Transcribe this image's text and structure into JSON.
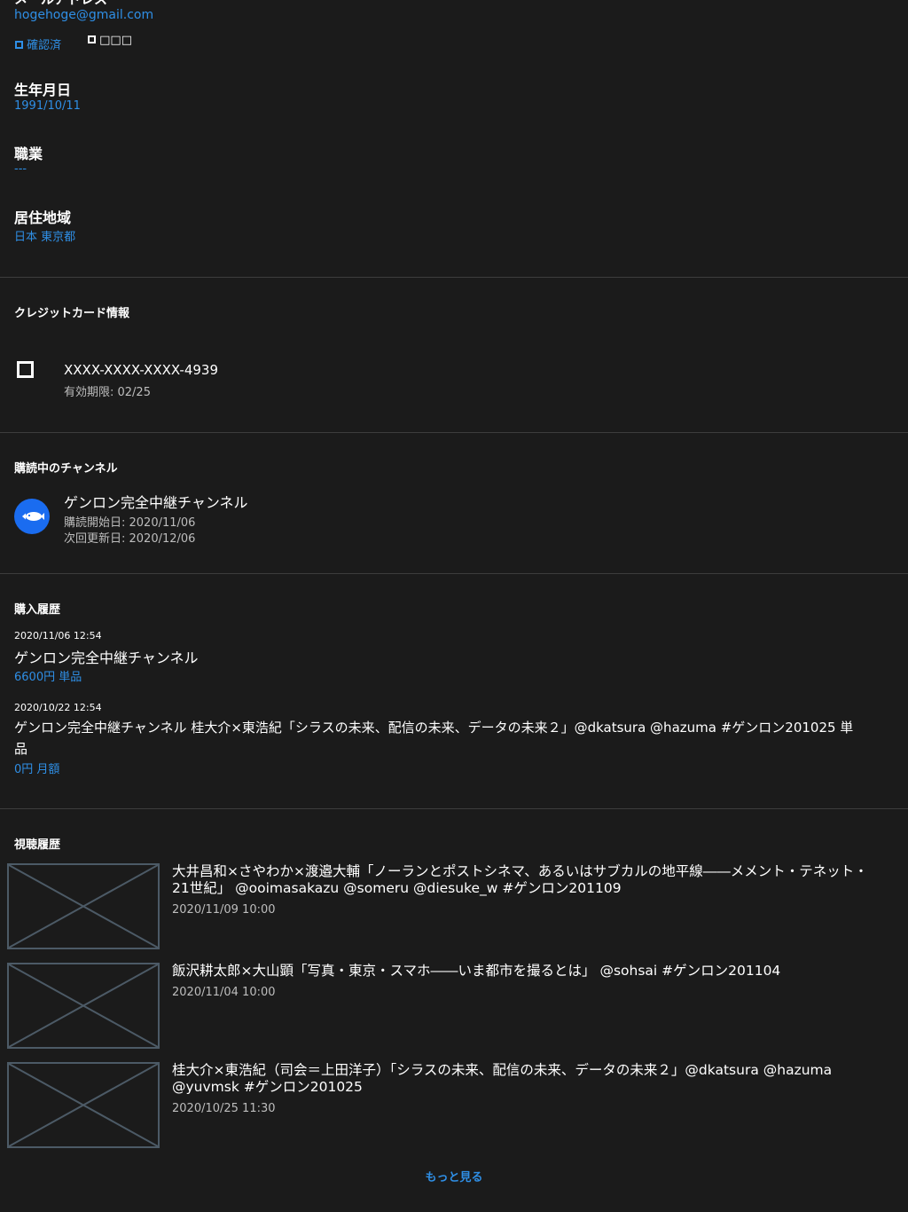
{
  "account": {
    "email_label_partial": "メールアドレス",
    "email": "hogehoge@gmail.com",
    "verified_label": "確認済",
    "unverified_marks": "□□□",
    "birthday_label": "生年月日",
    "birthday": "1991/10/11",
    "occupation_label": "職業",
    "occupation": "---",
    "region_label": "居住地域",
    "region": "日本 東京都"
  },
  "credit_card": {
    "section_title": "クレジットカード情報",
    "number": "XXXX-XXXX-XXXX-4939",
    "expiry": "有効期限: 02/25"
  },
  "subscriptions": {
    "section_title": "購読中のチャンネル",
    "items": [
      {
        "name": "ゲンロン完全中継チャンネル",
        "start": "購読開始日: 2020/11/06",
        "renew": "次回更新日: 2020/12/06",
        "icon": "fish-icon",
        "icon_color": "#1a6cf0"
      }
    ]
  },
  "purchases": {
    "section_title": "購入履歴",
    "items": [
      {
        "datetime": "2020/11/06 12:54",
        "title": "ゲンロン完全中継チャンネル",
        "price": "6600円 単品"
      },
      {
        "datetime": "2020/10/22 12:54",
        "title_line1": "ゲンロン完全中継チャンネル 桂大介×東浩紀「シラスの未来、配信の未来、データの未来２」@dkatsura @hazuma #ゲンロン201025 単",
        "title_line2": "品",
        "price": "0円 月額"
      }
    ]
  },
  "history": {
    "section_title": "視聴履歴",
    "items": [
      {
        "title_line1": "大井昌和×さやわか×渡邉大輔「ノーランとポストシネマ、あるいはサブカルの地平線――メメント・テネット・",
        "title_line2": "21世紀」 @ooimasakazu @someru @diesuke_w #ゲンロン201109",
        "date": "2020/11/09 10:00"
      },
      {
        "title_line1": "飯沢耕太郎×大山顕「写真・東京・スマホ――いま都市を撮るとは」 @sohsai #ゲンロン201104",
        "title_line2": "",
        "date": "2020/11/04 10:00"
      },
      {
        "title_line1": "桂大介×東浩紀（司会＝上田洋子）「シラスの未来、配信の未来、データの未来２」@dkatsura @hazuma",
        "title_line2": "@yuvmsk #ゲンロン201025",
        "date": "2020/10/25 11:30"
      }
    ],
    "more_label": "もっと見る"
  },
  "colors": {
    "background": "#1b1b1b",
    "accent": "#2f8fe6",
    "divider": "#3d3d3d"
  }
}
